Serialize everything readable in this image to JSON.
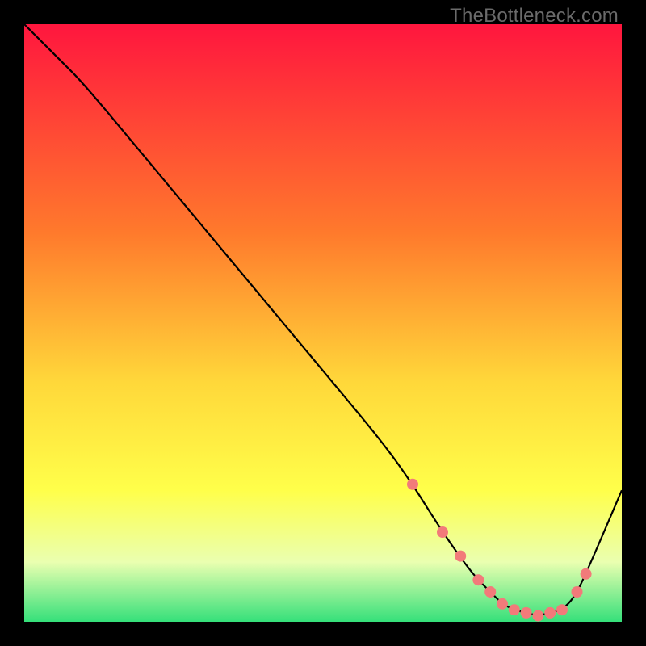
{
  "watermark": "TheBottleneck.com",
  "colors": {
    "black": "#000000",
    "curve": "#000000",
    "dot_fill": "#f27a7a",
    "dot_stroke": "#f27a7a",
    "grad_top": "#ff163e",
    "grad_mid1": "#ff6a2c",
    "grad_mid2": "#ffd83a",
    "grad_mid3": "#ffff4a",
    "grad_mid4": "#eaffb0",
    "grad_bottom": "#35e07a"
  },
  "chart_data": {
    "type": "line",
    "title": "",
    "xlabel": "",
    "ylabel": "",
    "xlim": [
      0,
      100
    ],
    "ylim": [
      0,
      100
    ],
    "series": [
      {
        "name": "curve",
        "x": [
          0,
          6,
          10,
          20,
          30,
          40,
          50,
          60,
          65,
          70,
          75,
          78,
          80,
          82,
          84,
          86,
          88,
          90,
          92,
          94,
          100
        ],
        "values": [
          100,
          94,
          90,
          78,
          66,
          54,
          42,
          30,
          23,
          15,
          8,
          5,
          3,
          2,
          1.5,
          1,
          1.5,
          2,
          4,
          8,
          22
        ]
      }
    ],
    "markers": {
      "name": "dots",
      "x": [
        65,
        70,
        73,
        76,
        78,
        80,
        82,
        84,
        86,
        88,
        90,
        92.5,
        94
      ],
      "values": [
        23,
        15,
        11,
        7,
        5,
        3,
        2,
        1.5,
        1,
        1.5,
        2,
        5,
        8
      ]
    },
    "background": {
      "type": "vertical-gradient",
      "stops": [
        {
          "offset": 0.0,
          "color": "#ff163e"
        },
        {
          "offset": 0.35,
          "color": "#ff7a2c"
        },
        {
          "offset": 0.6,
          "color": "#ffd83a"
        },
        {
          "offset": 0.78,
          "color": "#ffff4a"
        },
        {
          "offset": 0.9,
          "color": "#eaffb0"
        },
        {
          "offset": 1.0,
          "color": "#35e07a"
        }
      ]
    }
  }
}
